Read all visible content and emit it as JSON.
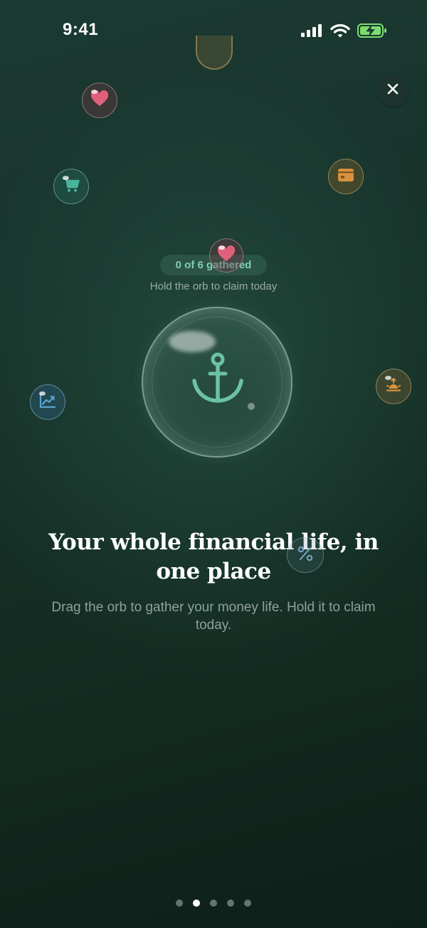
{
  "status_bar": {
    "time": "9:41",
    "icons": [
      "cellular-signal-icon",
      "wifi-icon",
      "battery-charging-icon"
    ]
  },
  "close_button": {
    "label": "×",
    "icon": "close-icon"
  },
  "floating_items": [
    {
      "icon": "heart-icon",
      "color": "#e0607a"
    },
    {
      "icon": "shopping-cart-icon",
      "color": "#49b39b"
    },
    {
      "icon": "wallet-icon",
      "color": "#d9923f"
    },
    {
      "icon": "heart-icon",
      "color": "#e0607a"
    },
    {
      "icon": "trending-chart-icon",
      "color": "#5aa2cf"
    },
    {
      "icon": "sunrise-icon",
      "color": "#d9923f"
    },
    {
      "icon": "percent-icon",
      "color": "#7aa7c2"
    }
  ],
  "counter": {
    "text": "0 of 6 gathered"
  },
  "hint": {
    "text": "Hold the orb to claim today"
  },
  "orb": {
    "icon": "anchor-icon",
    "color": "#6cc2a6"
  },
  "headline": "Your whole financial life, in one place",
  "subtext": "Drag the orb to gather your money life. Hold it to claim today.",
  "pager": {
    "total": 5,
    "active_index": 1
  }
}
